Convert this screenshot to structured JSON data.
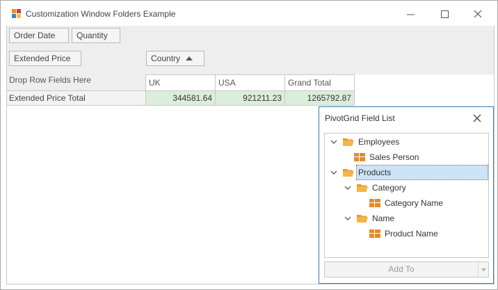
{
  "window": {
    "title": "Customization Window Folders Example"
  },
  "pivot": {
    "filter_fields": [
      "Order Date",
      "Quantity"
    ],
    "data_field": "Extended Price",
    "column_field": "Country",
    "drop_row_text": "Drop Row Fields Here",
    "columns": [
      "UK",
      "USA",
      "Grand Total"
    ],
    "row_header": "Extended Price Total",
    "values": [
      "344581.64",
      "921211.23",
      "1265792.87"
    ]
  },
  "field_list": {
    "title": "PivotGrid Field List",
    "nodes": [
      {
        "label": "Employees",
        "type": "folder",
        "expanded": true
      },
      {
        "label": "Sales Person",
        "type": "field"
      },
      {
        "label": "Products",
        "type": "folder",
        "expanded": true,
        "selected": true
      },
      {
        "label": "Category",
        "type": "folder",
        "expanded": true
      },
      {
        "label": "Category Name",
        "type": "field"
      },
      {
        "label": "Name",
        "type": "folder",
        "expanded": true
      },
      {
        "label": "Product Name",
        "type": "field"
      }
    ],
    "add_to_label": "Add To"
  },
  "colors": {
    "cell_bg": "#dbeedb",
    "selection": "#cce4f7",
    "folder": "#f0a030",
    "field_icon": "#e8892a",
    "accent_border": "#3d78b6"
  }
}
